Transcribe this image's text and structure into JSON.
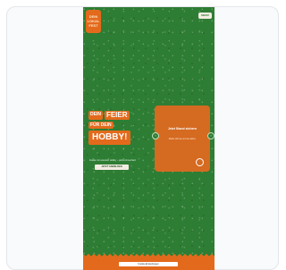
{
  "logo": {
    "lines": [
      "DEIN",
      "LOKAL",
      "FEST"
    ]
  },
  "header": {
    "menu_label": "MENÜ"
  },
  "hero": {
    "word1": "DEIN",
    "word2": "FEIER",
    "word3": "FÜR DEIN",
    "word4": "HOBBY!",
    "subtitle": "Feiere mit uns dein Hobby – jetzt mitmachen!",
    "cta_label": "JETZT ANMELDEN"
  },
  "slide": {
    "title": "Jetzt Stand sichern",
    "text": "Melde dich an und sei dabei."
  },
  "footer": {
    "cookie_text": "Cookie-Einstellungen"
  },
  "colors": {
    "background": "#2e7d34",
    "accent": "#e36a1c",
    "cream": "#f3ece2"
  }
}
